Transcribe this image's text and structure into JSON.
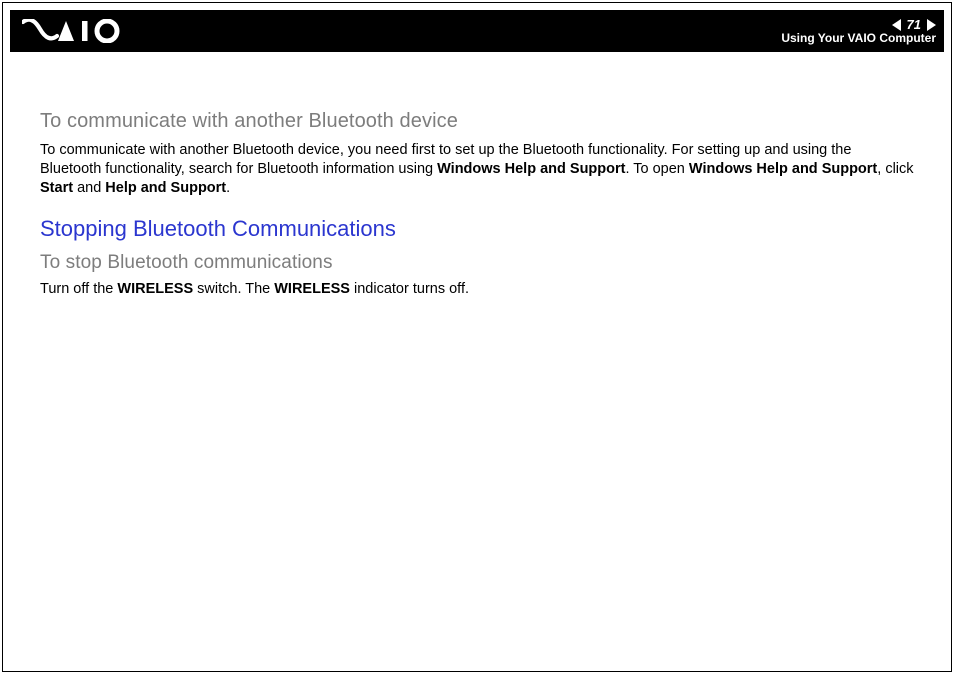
{
  "header": {
    "page_number": "71",
    "section": "Using Your VAIO Computer"
  },
  "content": {
    "sub1_title": "To communicate with another Bluetooth device",
    "p1_a": "To communicate with another Bluetooth device, you need first to set up the Bluetooth functionality. For setting up and using the Bluetooth functionality, search for Bluetooth information using ",
    "p1_b1": "Windows Help and Support",
    "p1_c": ". To open ",
    "p1_b2": "Windows Help and Support",
    "p1_d": ", click ",
    "p1_b3": "Start",
    "p1_e": " and ",
    "p1_b4": "Help and Support",
    "p1_f": ".",
    "section_title": "Stopping Bluetooth Communications",
    "sub2_title": "To stop Bluetooth communications",
    "p2_a": "Turn off the ",
    "p2_b1": "WIRELESS",
    "p2_c": " switch. The ",
    "p2_b2": "WIRELESS",
    "p2_d": " indicator turns off."
  }
}
